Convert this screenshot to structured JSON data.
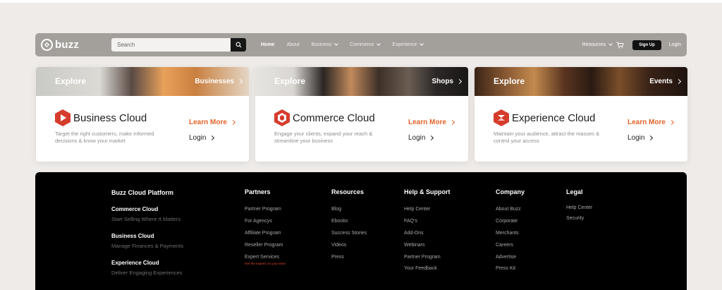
{
  "nav": {
    "logo_text": "buzz",
    "search_placeholder": "Search",
    "links": [
      "Home",
      "About",
      "Business",
      "Commerce",
      "Experience"
    ],
    "resources": "Resources",
    "signup": "Sign Up",
    "login": "Login"
  },
  "cards": [
    {
      "explore": "Explore",
      "banner_link": "Businesses",
      "title": "Business Cloud",
      "description": "Target the right customers, make informed decisions & know your market",
      "learn_more": "Learn More",
      "login": "Login"
    },
    {
      "explore": "Explore",
      "banner_link": "Shops",
      "title": "Commerce Cloud",
      "description": "Engage your clients, expand your reach & streamline your business",
      "learn_more": "Learn More",
      "login": "Login"
    },
    {
      "explore": "Explore",
      "banner_link": "Events",
      "title": "Experience Cloud",
      "description": "Maintain your audience, attract the masses & control your access",
      "learn_more": "Learn More",
      "login": "Login"
    }
  ],
  "footer": {
    "platform": {
      "heading": "Buzz Cloud Platform",
      "items": [
        {
          "title": "Commerce Cloud",
          "sub": "Start Selling Where It Matters"
        },
        {
          "title": "Business Cloud",
          "sub": "Manage Finances & Payments"
        },
        {
          "title": "Experience Cloud",
          "sub": "Deliver Engaging Experiences"
        }
      ]
    },
    "partners": {
      "heading": "Partners",
      "items": [
        "Partner Program",
        "For Agencys",
        "Affiliate Program",
        "Reseller Program",
        "Expert Services"
      ],
      "note": "Get the experts on your team"
    },
    "resources": {
      "heading": "Resources",
      "items": [
        "Blog",
        "Ebooks",
        "Success Stories",
        "Videos",
        "Press"
      ]
    },
    "help": {
      "heading": "Help & Support",
      "items": [
        "Help Center",
        "FAQ's",
        "Add-Ons",
        "Webinars",
        "Partner Program",
        "Your Feedback"
      ]
    },
    "company": {
      "heading": "Company",
      "items": [
        "About Buzz",
        "Corporate",
        "Merchants",
        "Careers",
        "Advertise",
        "Press Kit"
      ]
    },
    "legal": {
      "heading": "Legal",
      "items": [
        "Help Center",
        "Security"
      ]
    }
  },
  "colors": {
    "accent": "#e3632a",
    "nav_bg": "#a39f9b",
    "brand_red": "#d63c2c",
    "footer_bg": "#000000"
  }
}
